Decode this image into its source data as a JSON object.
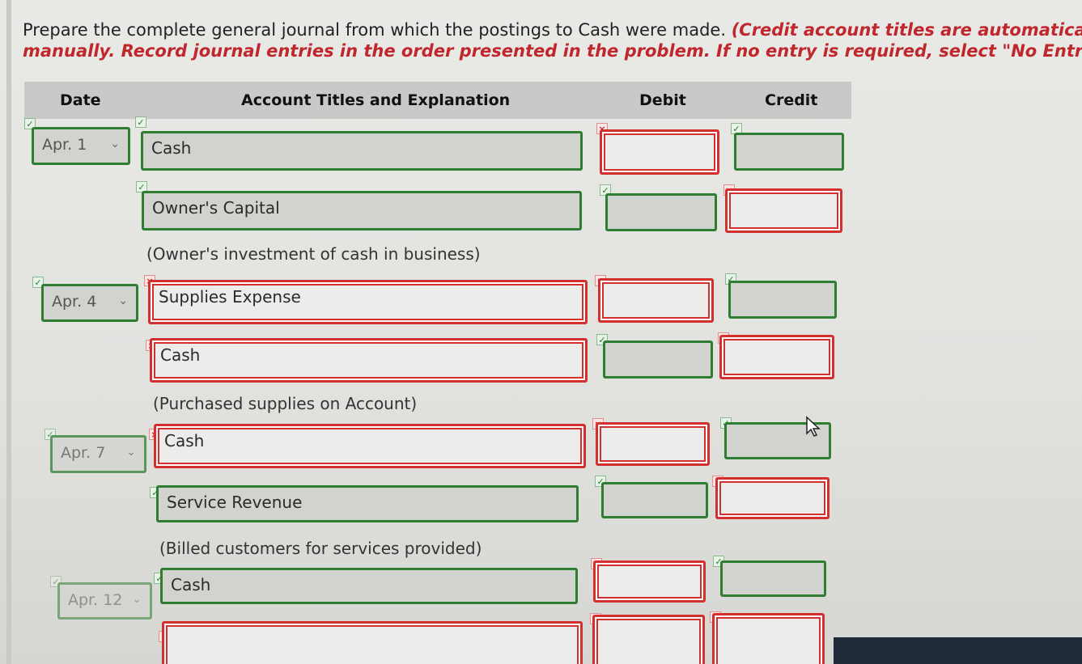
{
  "instructions": {
    "line1_plain": "Prepare the complete general journal from which the postings to Cash were made. ",
    "line1_red": "(Credit account titles are automatically inder",
    "line2_red": "manually. Record journal entries in the order presented in the problem. If no entry is required, select \"No Entry\" for the"
  },
  "table_header": {
    "date": "Date",
    "account": "Account Titles and Explanation",
    "debit": "Debit",
    "credit": "Credit"
  },
  "entries": [
    {
      "date": "Apr. 1",
      "debit_account": "Cash",
      "credit_account": "Owner's Capital",
      "explanation": "(Owner's investment of cash in business)"
    },
    {
      "date": "Apr. 4",
      "debit_account": "Supplies Expense",
      "credit_account": "Cash",
      "explanation": "(Purchased supplies on Account)"
    },
    {
      "date": "Apr. 7",
      "debit_account": "Cash",
      "credit_account": "Service Revenue",
      "explanation": "(Billed customers for services provided)"
    },
    {
      "date": "Apr. 12",
      "debit_account": "Cash",
      "credit_account": "",
      "explanation": ""
    }
  ],
  "marks": {
    "ok": "✓",
    "bad": "×"
  },
  "chevron": "⌄",
  "colors": {
    "correct": "#2e7d32",
    "incorrect": "#d32f2f",
    "instruction_red": "#c0272d"
  }
}
